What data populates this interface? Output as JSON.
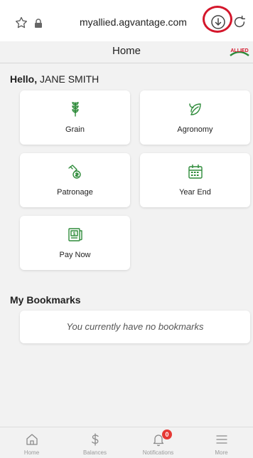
{
  "browser": {
    "url": "myallied.agvantage.com",
    "icons": [
      "star-icon",
      "lock-icon",
      "download-icon",
      "reload-icon"
    ]
  },
  "header": {
    "title": "Home",
    "logo_text": "ALLIED"
  },
  "greeting": {
    "prefix": "Hello,",
    "name": "JANE SMITH"
  },
  "tiles": [
    {
      "label": "Grain",
      "icon": "wheat-icon"
    },
    {
      "label": "Agronomy",
      "icon": "leaf-icon"
    },
    {
      "label": "Patronage",
      "icon": "money-hand-icon"
    },
    {
      "label": "Year End",
      "icon": "calendar-icon"
    },
    {
      "label": "Pay Now",
      "icon": "pay-invoice-icon"
    }
  ],
  "bookmarks": {
    "heading": "My Bookmarks",
    "empty_message": "You currently have no bookmarks"
  },
  "bottom_nav": [
    {
      "label": "Home",
      "icon": "home-icon"
    },
    {
      "label": "Balances",
      "icon": "dollar-icon"
    },
    {
      "label": "Notifications",
      "icon": "bell-icon",
      "badge": "0"
    },
    {
      "label": "More",
      "icon": "menu-icon"
    }
  ],
  "colors": {
    "accent_green": "#2e8b3a",
    "highlight_red": "#d4162b",
    "badge_red": "#e53935",
    "background": "#f2f2f2"
  }
}
